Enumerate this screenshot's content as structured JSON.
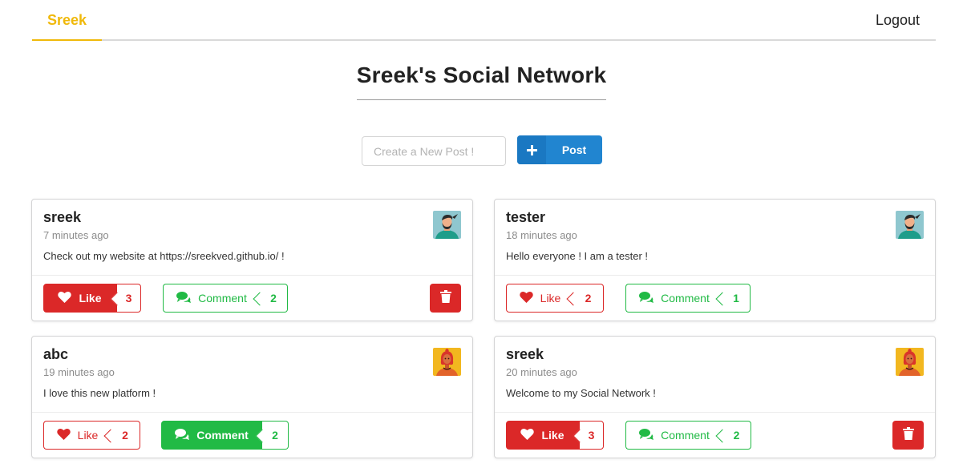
{
  "nav": {
    "brand": "Sreek",
    "logout": "Logout"
  },
  "page": {
    "title": "Sreek's Social Network"
  },
  "new_post": {
    "placeholder": "Create a New Post !",
    "button_label": "Post",
    "button_icon": "plus-icon"
  },
  "colors": {
    "brand": "#f0b90b",
    "primary": "#2185d0",
    "like": "#db2828",
    "comment": "#21ba45"
  },
  "posts": [
    {
      "user": "sreek",
      "time": "7 minutes ago",
      "text": "Check out my website at https://sreekved.github.io/ !",
      "avatar": "man-avatar-icon",
      "like_label": "Like",
      "likes": "3",
      "liked": true,
      "comment_label": "Comment",
      "comments": "2",
      "comment_active": false,
      "deletable": true
    },
    {
      "user": "tester",
      "time": "18 minutes ago",
      "text": "Hello everyone ! I am a tester !",
      "avatar": "man-avatar-icon",
      "like_label": "Like",
      "likes": "2",
      "liked": false,
      "comment_label": "Comment",
      "comments": "1",
      "comment_active": false,
      "deletable": false
    },
    {
      "user": "abc",
      "time": "19 minutes ago",
      "text": "I love this new platform !",
      "avatar": "woman-avatar-icon",
      "like_label": "Like",
      "likes": "2",
      "liked": false,
      "comment_label": "Comment",
      "comments": "2",
      "comment_active": true,
      "deletable": false
    },
    {
      "user": "sreek",
      "time": "20 minutes ago",
      "text": "Welcome to my Social Network !",
      "avatar": "woman-avatar-icon",
      "like_label": "Like",
      "likes": "3",
      "liked": true,
      "comment_label": "Comment",
      "comments": "2",
      "comment_active": false,
      "deletable": true
    }
  ]
}
